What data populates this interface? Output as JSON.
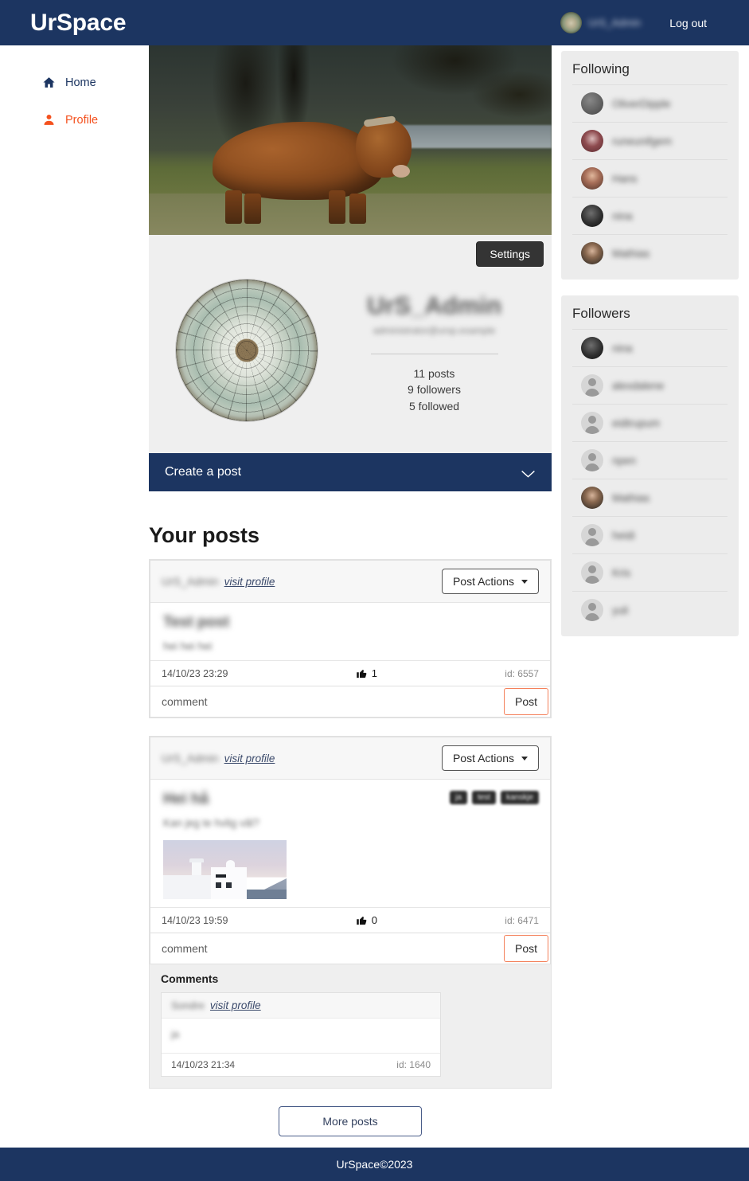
{
  "navbar": {
    "brand": "UrSpace",
    "username": "UrS_Admin",
    "logout_label": "Log out",
    "avatar_icon": "user-avatar-image"
  },
  "sidebar_left": {
    "items": [
      {
        "label": "Home",
        "icon": "home-icon",
        "color": "#1c3561"
      },
      {
        "label": "Profile",
        "icon": "person-icon",
        "color": "#f4511e"
      }
    ]
  },
  "profile": {
    "banner_icon": "highland-cow-banner-image",
    "settings_label": "Settings",
    "avatar_icon": "glass-dome-profile-image",
    "display_name": "UrS_Admin",
    "subtitle": "administrator@ursp.example",
    "stats": {
      "posts": "11 posts",
      "followers": "9 followers",
      "followed": "5 followed"
    }
  },
  "create_post": {
    "label": "Create a post",
    "chevron_icon": "chevron-down-icon"
  },
  "posts_section": {
    "heading": "Your posts",
    "more_posts_label": "More posts",
    "post_actions_label": "Post Actions",
    "visit_profile_label": "visit profile",
    "comment_placeholder": "comment",
    "comment_post_label": "Post",
    "comments_heading": "Comments",
    "like_icon": "thumbs-up-icon",
    "items": [
      {
        "author": "UrS_Admin",
        "title": "Test post",
        "text": "hei hei hei",
        "timestamp": "14/10/23 23:29",
        "likes": "1",
        "id_label": "id: 6557",
        "tags": [],
        "has_image": false,
        "comments": []
      },
      {
        "author": "UrS_Admin",
        "title": "Hei hå",
        "text": "Kan jeg te hvlig vâl?",
        "timestamp": "14/10/23 19:59",
        "likes": "0",
        "id_label": "id: 6471",
        "tags": [
          "ja",
          "test",
          "kanskje"
        ],
        "has_image": true,
        "image_icon": "greek-building-photo",
        "comments": [
          {
            "author": "Sondre",
            "text": "ja",
            "timestamp": "14/10/23 21:34",
            "id_label": "id: 1640"
          }
        ]
      }
    ]
  },
  "following_panel": {
    "title": "Following",
    "people": [
      {
        "name": "OliverDipple",
        "avatar": "a-grey"
      },
      {
        "name": "runeunifgem",
        "avatar": "a-red"
      },
      {
        "name": "Hans",
        "avatar": "a-face"
      },
      {
        "name": "nina",
        "avatar": "a-dark"
      },
      {
        "name": "Mathias",
        "avatar": "a-port"
      }
    ]
  },
  "followers_panel": {
    "title": "Followers",
    "people": [
      {
        "name": "nina",
        "avatar": "a-dark"
      },
      {
        "name": "alexdalene",
        "avatar": "default"
      },
      {
        "name": "eidtrupum",
        "avatar": "default"
      },
      {
        "name": "npen",
        "avatar": "default"
      },
      {
        "name": "Mathias",
        "avatar": "a-port"
      },
      {
        "name": "heidi",
        "avatar": "default"
      },
      {
        "name": "Kris",
        "avatar": "default"
      },
      {
        "name": "yuli",
        "avatar": "default"
      }
    ]
  },
  "footer": {
    "text": "UrSpace©2023"
  },
  "colors": {
    "navy": "#1c3561",
    "accent_orange": "#f4511e",
    "panel_grey": "#ececec",
    "post_border_orange": "#f4805a"
  }
}
